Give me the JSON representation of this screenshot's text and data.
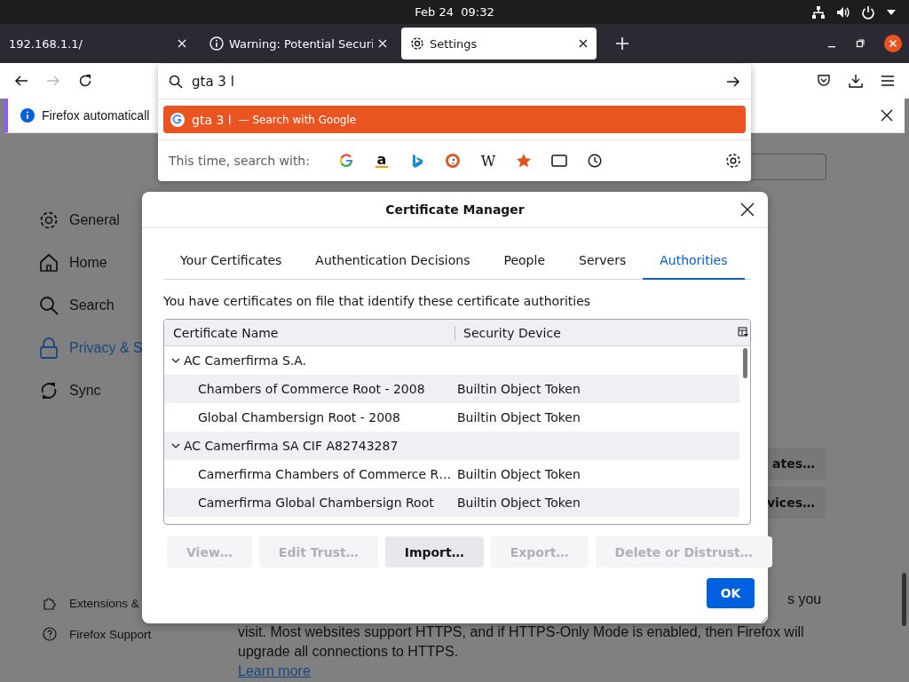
{
  "top_bar": {
    "clock": "Feb 24  09:32"
  },
  "tabs": [
    {
      "title": "192.168.1.1/",
      "kind": "plain",
      "selected": false
    },
    {
      "title": "Warning: Potential Securi",
      "kind": "info",
      "selected": false
    },
    {
      "title": "Settings",
      "kind": "settings",
      "selected": true
    }
  ],
  "nav_buttons": [
    {
      "kind": "back",
      "disabled": false
    },
    {
      "kind": "forward",
      "disabled": true
    },
    {
      "kind": "reload",
      "disabled": false
    }
  ],
  "notification": {
    "text": "Firefox automaticall"
  },
  "sidebar": {
    "items": [
      {
        "label": "General",
        "kind": "general",
        "selected": false
      },
      {
        "label": "Home",
        "kind": "home",
        "selected": false
      },
      {
        "label": "Search",
        "kind": "search",
        "selected": false
      },
      {
        "label": "Privacy & S",
        "kind": "privacy",
        "selected": true
      },
      {
        "label": "Sync",
        "kind": "sync",
        "selected": false
      }
    ],
    "footer": [
      {
        "label": "Extensions &",
        "kind": "extensions"
      },
      {
        "label": "Firefox Support",
        "kind": "support"
      }
    ]
  },
  "page": {
    "buttons": [
      "ates…",
      "vices…"
    ],
    "fragment": "s you",
    "lines": [
      "visit. Most websites support HTTPS, and if HTTPS-Only Mode is enabled, then Firefox will",
      "upgrade all connections to HTTPS."
    ],
    "link": "Learn more"
  },
  "urlbar_popup": {
    "query": "gta 3 l",
    "suggestion": {
      "text": "gta 3 l",
      "action": "— Search with Google"
    },
    "one_off_label": "This time, search with:",
    "engines": [
      {
        "kind": "google"
      },
      {
        "kind": "amazon",
        "glyph": "a"
      },
      {
        "kind": "bing"
      },
      {
        "kind": "duckduckgo"
      },
      {
        "kind": "wikipedia",
        "glyph": "W"
      },
      {
        "kind": "bookmarks"
      },
      {
        "kind": "tabs"
      },
      {
        "kind": "history"
      }
    ]
  },
  "dialog": {
    "title": "Certificate Manager",
    "tabs": [
      {
        "label": "Your Certificates",
        "selected": false
      },
      {
        "label": "Authentication Decisions",
        "selected": false
      },
      {
        "label": "People",
        "selected": false
      },
      {
        "label": "Servers",
        "selected": false
      },
      {
        "label": "Authorities",
        "selected": true
      }
    ],
    "description": "You have certificates on file that identify these certificate authorities",
    "columns": [
      "Certificate Name",
      "Security Device"
    ],
    "groups": [
      {
        "name": "AC Camerfirma S.A.",
        "expanded": true,
        "children": [
          {
            "name": "Chambers of Commerce Root - 2008",
            "device": "Builtin Object Token"
          },
          {
            "name": "Global Chambersign Root - 2008",
            "device": "Builtin Object Token"
          }
        ]
      },
      {
        "name": "AC Camerfirma SA CIF A82743287",
        "expanded": true,
        "children": [
          {
            "name": "Camerfirma Chambers of Commerce R…",
            "device": "Builtin Object Token"
          },
          {
            "name": "Camerfirma Global Chambersign Root",
            "device": "Builtin Object Token"
          }
        ]
      }
    ],
    "buttons": [
      {
        "label": "View…",
        "disabled": true
      },
      {
        "label": "Edit Trust…",
        "disabled": true
      },
      {
        "label": "Import…",
        "disabled": false
      },
      {
        "label": "Export…",
        "disabled": true
      },
      {
        "label": "Delete or Distrust…",
        "disabled": true
      }
    ],
    "ok": "OK"
  }
}
